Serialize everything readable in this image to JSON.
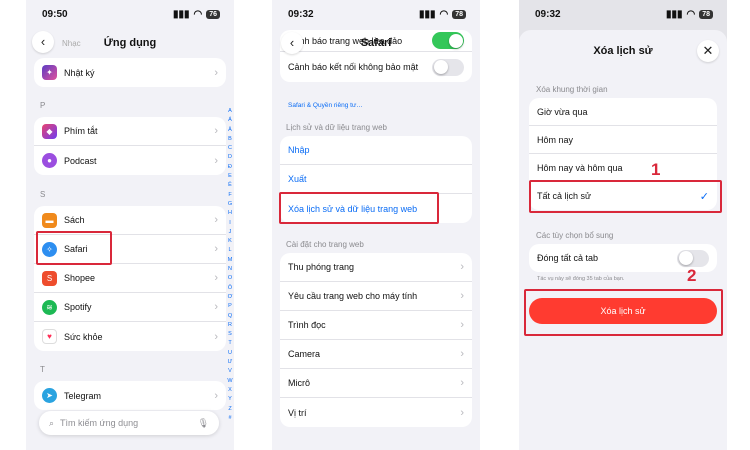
{
  "phone1": {
    "time": "09:50",
    "battery": "76",
    "back_icon": "chevron-left-icon",
    "header_hint": "Nhạc",
    "title": "Ứng dụng",
    "top_item": {
      "label": "Nhật ký",
      "icon": "journal-icon"
    },
    "section_p": "P",
    "p_items": [
      {
        "label": "Phím tắt",
        "icon": "shortcuts-icon"
      },
      {
        "label": "Podcast",
        "icon": "podcast-icon"
      }
    ],
    "section_s": "S",
    "s_items": [
      {
        "label": "Sách",
        "icon": "books-icon"
      },
      {
        "label": "Safari",
        "icon": "safari-icon"
      },
      {
        "label": "Shopee",
        "icon": "shopee-icon"
      },
      {
        "label": "Spotify",
        "icon": "spotify-icon"
      },
      {
        "label": "Sức khỏe",
        "icon": "health-icon"
      }
    ],
    "section_t": "T",
    "t_items": [
      {
        "label": "Telegram",
        "icon": "telegram-icon"
      }
    ],
    "search_placeholder": "Tìm kiếm ứng dụng",
    "index_letters": [
      "A",
      "Á",
      "Â",
      "B",
      "C",
      "D",
      "Đ",
      "E",
      "Ê",
      "F",
      "G",
      "H",
      "I",
      "J",
      "K",
      "L",
      "M",
      "N",
      "O",
      "Ô",
      "Ơ",
      "P",
      "Q",
      "R",
      "S",
      "T",
      "U",
      "Ư",
      "V",
      "W",
      "X",
      "Y",
      "Z",
      "#"
    ]
  },
  "phone2": {
    "time": "09:32",
    "battery": "78",
    "title": "Safari",
    "fraud_label": "Cảnh báo trang web lừa đảo",
    "fraud_on": true,
    "insecure_label": "Cảnh báo kết nối không bảo mật",
    "insecure_on": false,
    "privacy_link": "Safari & Quyền riêng tư…",
    "history_header": "Lịch sử và dữ liệu trang web",
    "history_items": [
      "Nhập",
      "Xuất",
      "Xóa lịch sử và dữ liệu trang web"
    ],
    "settings_header": "Cài đặt cho trang web",
    "settings_items": [
      "Thu phóng trang",
      "Yêu cầu trang web cho máy tính",
      "Trình đọc",
      "Camera",
      "Micrô",
      "Vị trí"
    ]
  },
  "phone3": {
    "time": "09:32",
    "battery": "78",
    "title": "Xóa lịch sử",
    "close_icon": "close-icon",
    "timeframe_header": "Xóa khung thời gian",
    "timeframe_options": [
      "Giờ vừa qua",
      "Hôm nay",
      "Hôm nay và hôm qua",
      "Tất cả lịch sử"
    ],
    "selected_option": "Tất cả lịch sử",
    "extra_header": "Các tùy chọn bổ sung",
    "close_tabs_label": "Đóng tất cả tab",
    "close_tabs_on": false,
    "close_tabs_note": "Tác vụ này sẽ đóng 35 tab của bạn.",
    "clear_button": "Xóa lịch sử",
    "accent": "#ff3b30"
  },
  "annotations": {
    "step1": "1",
    "step2": "2",
    "highlight_color": "#d9283a"
  }
}
